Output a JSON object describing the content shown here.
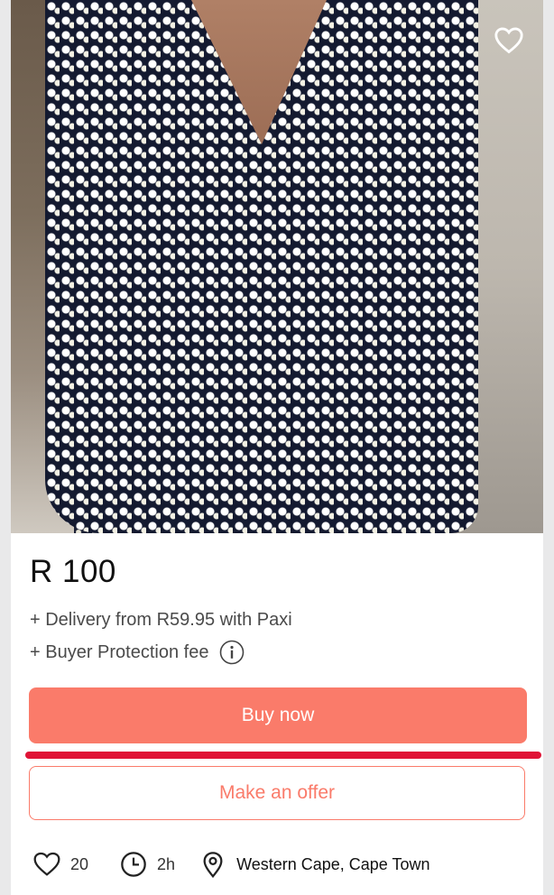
{
  "listing": {
    "price": "R 100",
    "delivery": "+ Delivery from R59.95 with Paxi",
    "buyer_protection": "+ Buyer Protection fee",
    "buy_label": "Buy now",
    "offer_label": "Make an offer",
    "likes": "20",
    "age": "2h",
    "location": "Western Cape, Cape Town"
  },
  "icons": {
    "favorite": "heart-outline-icon",
    "info": "info-circle-icon",
    "likes": "heart-outline-icon",
    "time": "clock-icon",
    "location": "map-pin-icon"
  },
  "colors": {
    "accent": "#fa7b6a",
    "highlight": "#e01437",
    "background": "#e9e9ea"
  }
}
